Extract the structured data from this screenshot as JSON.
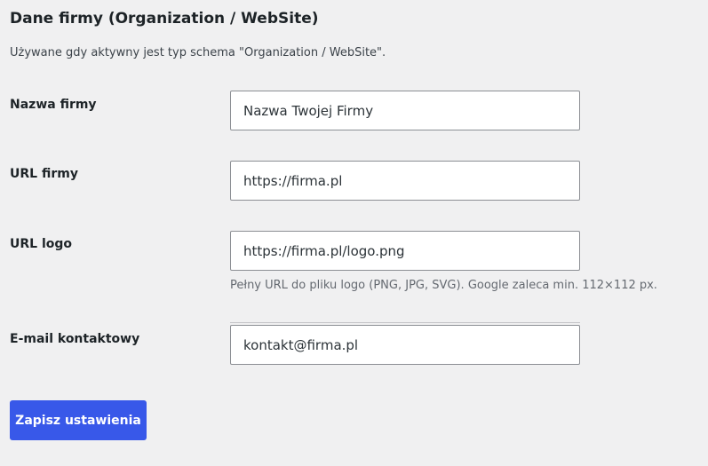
{
  "section": {
    "title": "Dane firmy (Organization / WebSite)",
    "description": "Używane gdy aktywny jest typ schema \"Organization / WebSite\"."
  },
  "fields": {
    "company_name": {
      "label": "Nazwa firmy",
      "value": "Nazwa Twojej Firmy"
    },
    "company_url": {
      "label": "URL firmy",
      "value": "https://firma.pl"
    },
    "logo_url": {
      "label": "URL logo",
      "value": "https://firma.pl/logo.png",
      "help": "Pełny URL do pliku logo (PNG, JPG, SVG). Google zaleca min. 112×112 px."
    },
    "contact_email": {
      "label": "E-mail kontaktowy",
      "value": "kontakt@firma.pl"
    }
  },
  "actions": {
    "save_label": "Zapisz ustawienia"
  },
  "colors": {
    "background": "#f0f0f1",
    "accent": "#3858e9",
    "text": "#1d2327",
    "muted": "#646970"
  }
}
